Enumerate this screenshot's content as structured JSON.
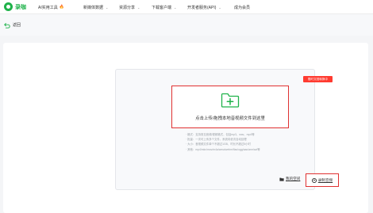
{
  "app": {
    "logo_text": "录咖"
  },
  "nav": {
    "items": [
      {
        "label": "AI实用工具",
        "hot": "🔥"
      },
      {
        "label": "新媒体数据"
      },
      {
        "label": "资源分享"
      },
      {
        "label": "下载客户端"
      },
      {
        "label": "开发者服务(API)"
      },
      {
        "label": "成为会员"
      }
    ]
  },
  "back": {
    "label": "返回"
  },
  "upload": {
    "badge": "限时文档转换中",
    "drop_label": "点击上传/拖拽本地音视频文件到这里",
    "hints": [
      "· 格式：支持常见音频/视频格式，包括mp3、wav、mp4等",
      "· 批量：一次可上传多个文件，系统将依次自动处理",
      "· 大小：音视频文件单个不超过1GB，时长不超过5小时",
      "· 其他：mp4/mkv/mov/m4a/wma/webm/flac/ogg/aac/amr/avi等"
    ],
    "my_space": "我的空间",
    "record": "录制音频"
  },
  "colors": {
    "brand": "#1fb24a",
    "highlight_red": "#e03131"
  }
}
